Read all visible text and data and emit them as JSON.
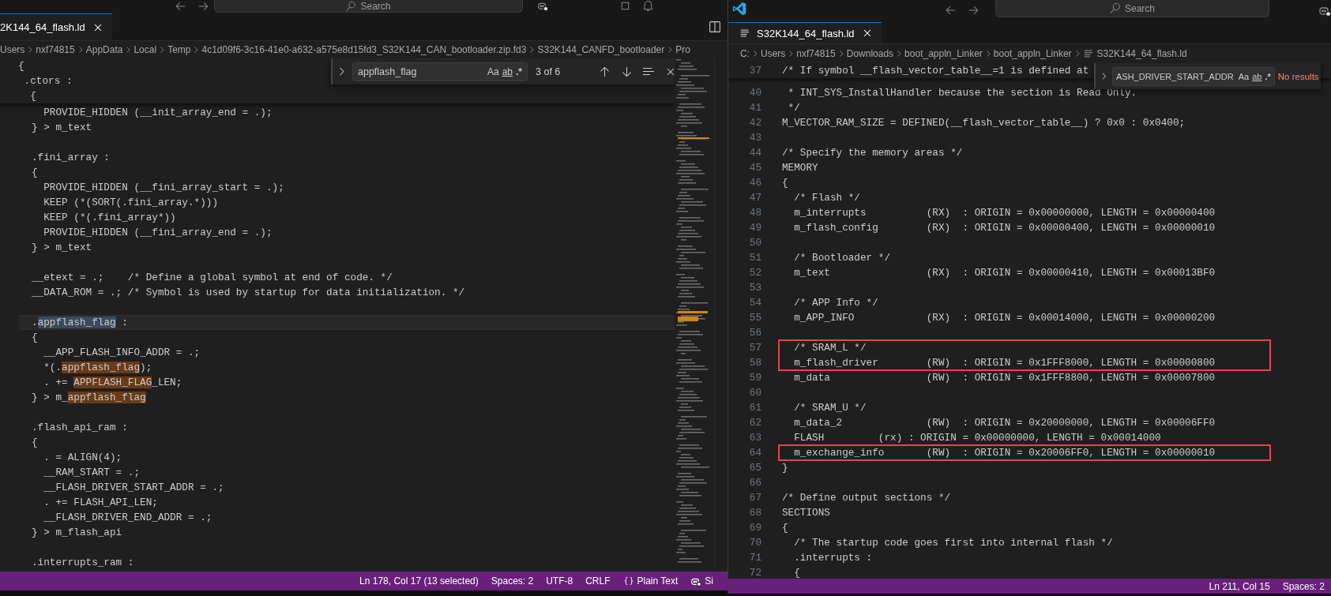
{
  "left_window": {
    "title_bar": {
      "search": "Search"
    },
    "tab": {
      "label": "2K144_64_flash.ld",
      "selected": true
    },
    "breadcrumb": [
      "Users",
      "nxf74815",
      "AppData",
      "Local",
      "Temp",
      "4c1d09f6-3c16-41e0-a632-a575e8d15fd3_S32K144_CAN_bootloader.zip.fd3",
      "S32K144_CANFD_bootloader",
      "Pro"
    ],
    "find": {
      "value": "appflash_flag",
      "options": [
        {
          "label": "Aa",
          "kind": "case"
        },
        {
          "label": "ab",
          "kind": "word"
        },
        {
          "label": ".*",
          "kind": "regex"
        }
      ],
      "result": "3 of 6"
    },
    "sticky_lines": [
      "{",
      " .ctors :",
      "  {"
    ],
    "lines": [
      {
        "text": "  PROVIDE_HIDDEN (__init_array_end = .);",
        "current": false
      },
      {
        "text": "} > m_text",
        "current": false
      },
      {
        "current": false
      },
      {
        "text": ".fini_array :",
        "current": false
      },
      {
        "text": "{",
        "current": false
      },
      {
        "text": "  PROVIDE_HIDDEN (__fini_array_start = .);",
        "current": false
      },
      {
        "text": "  KEEP (*(SORT(.fini_array.*)))",
        "current": false
      },
      {
        "text": "  KEEP (*(.fini_array*))",
        "current": false
      },
      {
        "text": "  PROVIDE_HIDDEN (__fini_array_end = .);",
        "current": false
      },
      {
        "text": "} > m_text",
        "current": false
      },
      {
        "current": false
      },
      {
        "text": "__etext = .;    /* Define a global symbol at end of code. */",
        "current": false
      },
      {
        "text": "__DATA_ROM = .; /* Symbol is used by startup for data initialization. */",
        "current": false
      },
      {
        "current": false
      },
      {
        "parts": [
          {
            "text": ".",
            "kind": "plain"
          },
          {
            "text": "appflash_flag",
            "kind": "selection"
          },
          {
            "text": " :",
            "kind": "plain"
          }
        ],
        "current": true
      },
      {
        "text": "{",
        "current": false
      },
      {
        "text": "  __APP_FLASH_INFO_ADDR = .;",
        "current": false
      },
      {
        "parts": [
          {
            "text": "  *(.",
            "kind": "plain"
          },
          {
            "text": "appflash_flag",
            "kind": "match"
          },
          {
            "text": ");",
            "kind": "plain"
          }
        ],
        "current": false
      },
      {
        "parts": [
          {
            "text": "  . += ",
            "kind": "plain"
          },
          {
            "text": "APPFLASH_FLAG",
            "kind": "match"
          },
          {
            "text": "_LEN;",
            "kind": "plain"
          }
        ],
        "current": false
      },
      {
        "parts": [
          {
            "text": "} > m_",
            "kind": "plain"
          },
          {
            "text": "appflash_flag",
            "kind": "match"
          }
        ],
        "current": false
      },
      {
        "current": false
      },
      {
        "text": ".flash_api_ram :",
        "current": false
      },
      {
        "text": "{",
        "current": false
      },
      {
        "text": "  . = ALIGN(4);",
        "current": false
      },
      {
        "text": "  __RAM_START = .;",
        "current": false
      },
      {
        "text": "  __FLASH_DRIVER_START_ADDR = .;",
        "current": false
      },
      {
        "text": "  . += FLASH_API_LEN;",
        "current": false
      },
      {
        "text": "  __FLASH_DRIVER_END_ADDR = .;",
        "current": false
      },
      {
        "text": "} > m_flash_api",
        "current": false
      },
      {
        "current": false
      },
      {
        "text": ".interrupts_ram :",
        "current": false
      }
    ],
    "status_bar": [
      {
        "text": "Ln 178, Col 17 (13 selected)",
        "kind": "plain"
      },
      {
        "text": "Spaces: 2",
        "kind": "plain"
      },
      {
        "text": "UTF-8",
        "kind": "plain"
      },
      {
        "text": "CRLF",
        "kind": "plain"
      },
      {
        "text": "Plain Text",
        "kind": "language"
      },
      {
        "text": "Si",
        "kind": "assistant"
      }
    ]
  },
  "right_window": {
    "title_bar": {
      "search": "Search"
    },
    "tab": {
      "label": "S32K144_64_flash.ld",
      "selected": true
    },
    "breadcrumb": [
      "C:",
      "Users",
      "nxf74815",
      "Downloads",
      "boot_appln_Linker",
      "boot_appln_Linker",
      "S32K144_64_flash.ld"
    ],
    "find": {
      "value": "ASH_DRIVER_START_ADDR",
      "options": [
        {
          "label": "Aa",
          "kind": "case"
        },
        {
          "label": "ab",
          "kind": "word"
        },
        {
          "label": ".*",
          "kind": "regex"
        }
      ],
      "result": "No results"
    },
    "sticky_line": {
      "number": "37",
      "text": "/* If symbol __flash_vector_table__=1 is defined at"
    },
    "lines": [
      {
        "number": "40",
        "text": " * INT_SYS_InstallHandler because the section is Read Only.",
        "boxed": false
      },
      {
        "number": "41",
        "text": " */",
        "boxed": false
      },
      {
        "number": "42",
        "text": "M_VECTOR_RAM_SIZE = DEFINED(__flash_vector_table__) ? 0x0 : 0x0400;",
        "boxed": false
      },
      {
        "number": "43",
        "boxed": false
      },
      {
        "number": "44",
        "text": "/* Specify the memory areas */",
        "boxed": false
      },
      {
        "number": "45",
        "text": "MEMORY",
        "boxed": false
      },
      {
        "number": "46",
        "text": "{",
        "boxed": false
      },
      {
        "number": "47",
        "text": "  /* Flash */",
        "boxed": false
      },
      {
        "number": "48",
        "text": "  m_interrupts          (RX)  : ORIGIN = 0x00000000, LENGTH = 0x00000400",
        "boxed": false
      },
      {
        "number": "49",
        "text": "  m_flash_config        (RX)  : ORIGIN = 0x00000400, LENGTH = 0x00000010",
        "boxed": false
      },
      {
        "number": "50",
        "boxed": false
      },
      {
        "number": "51",
        "text": "  /* Bootloader */",
        "boxed": false
      },
      {
        "number": "52",
        "text": "  m_text                (RX)  : ORIGIN = 0x00000410, LENGTH = 0x00013BF0",
        "boxed": false
      },
      {
        "number": "53",
        "boxed": false
      },
      {
        "number": "54",
        "text": "  /* APP Info */",
        "boxed": false
      },
      {
        "number": "55",
        "text": "  m_APP_INFO            (RX)  : ORIGIN = 0x00014000, LENGTH = 0x00000200",
        "boxed": false
      },
      {
        "number": "56",
        "boxed": false
      },
      {
        "number": "57",
        "text": "  /* SRAM_L */",
        "boxed": true
      },
      {
        "number": "58",
        "text": "  m_flash_driver        (RW)  : ORIGIN = 0x1FFF8000, LENGTH = 0x00000800",
        "boxed": true
      },
      {
        "number": "59",
        "text": "  m_data                (RW)  : ORIGIN = 0x1FFF8800, LENGTH = 0x00007800",
        "boxed": false
      },
      {
        "number": "60",
        "boxed": false
      },
      {
        "number": "61",
        "text": "  /* SRAM_U */",
        "boxed": false
      },
      {
        "number": "62",
        "text": "  m_data_2              (RW)  : ORIGIN = 0x20000000, LENGTH = 0x00006FF0",
        "boxed": false
      },
      {
        "number": "63",
        "text": "  FLASH         (rx) : ORIGIN = 0x00000000, LENGTH = 0x00014000",
        "boxed": false
      },
      {
        "number": "64",
        "text": "  m_exchange_info       (RW)  : ORIGIN = 0x20006FF0, LENGTH = 0x00000010",
        "boxed": true
      },
      {
        "number": "65",
        "text": "}",
        "boxed": false
      },
      {
        "number": "66",
        "boxed": false
      },
      {
        "number": "67",
        "text": "/* Define output sections */",
        "boxed": false
      },
      {
        "number": "68",
        "text": "SECTIONS",
        "boxed": false
      },
      {
        "number": "69",
        "text": "{",
        "boxed": false
      },
      {
        "number": "70",
        "text": "  /* The startup code goes first into internal flash */",
        "boxed": false
      },
      {
        "number": "71",
        "text": "  .interrupts :",
        "boxed": false
      },
      {
        "number": "72",
        "text": "  {",
        "boxed": false
      }
    ],
    "status_bar": [
      {
        "text": "Ln 211, Col 15",
        "kind": "plain"
      },
      {
        "text": "Spaces: 2",
        "kind": "plain"
      }
    ]
  }
}
